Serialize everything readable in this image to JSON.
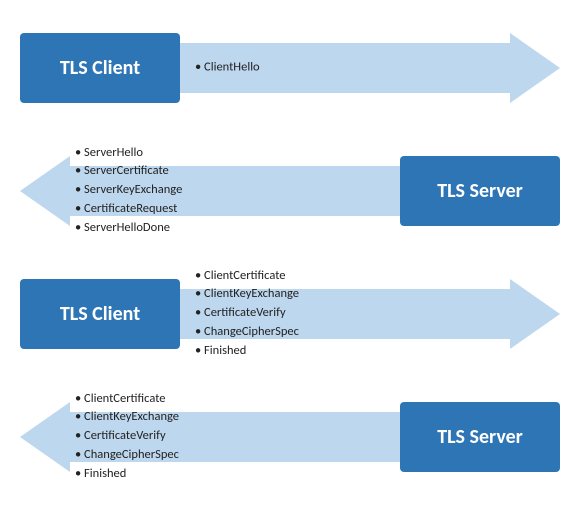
{
  "rows": [
    {
      "direction": "right",
      "label": "TLS Client",
      "bullets": [
        "ClientHello"
      ],
      "arrowColor": "#BDD7EE",
      "arrowColorDark": "#9DC3E6"
    },
    {
      "direction": "left",
      "label": "TLS Server",
      "bullets": [
        "ServerHello",
        "ServerCertificate",
        "ServerKeyExchange",
        "CertificateRequest",
        "ServerHelloDone"
      ],
      "arrowColor": "#BDD7EE",
      "arrowColorDark": "#9DC3E6"
    },
    {
      "direction": "right",
      "label": "TLS Client",
      "bullets": [
        "ClientCertificate",
        "ClientKeyExchange",
        "CertificateVerify",
        "ChangeCipherSpec",
        "Finished"
      ],
      "arrowColor": "#BDD7EE",
      "arrowColorDark": "#9DC3E6"
    },
    {
      "direction": "left",
      "label": "TLS Server",
      "bullets": [
        "ClientCertificate",
        "ClientKeyExchange",
        "CertificateVerify",
        "ChangeCipherSpec",
        "Finished"
      ],
      "arrowColor": "#BDD7EE",
      "arrowColorDark": "#9DC3E6"
    }
  ],
  "labelColor": "#2E75B6",
  "labelTextColor": "#ffffff"
}
